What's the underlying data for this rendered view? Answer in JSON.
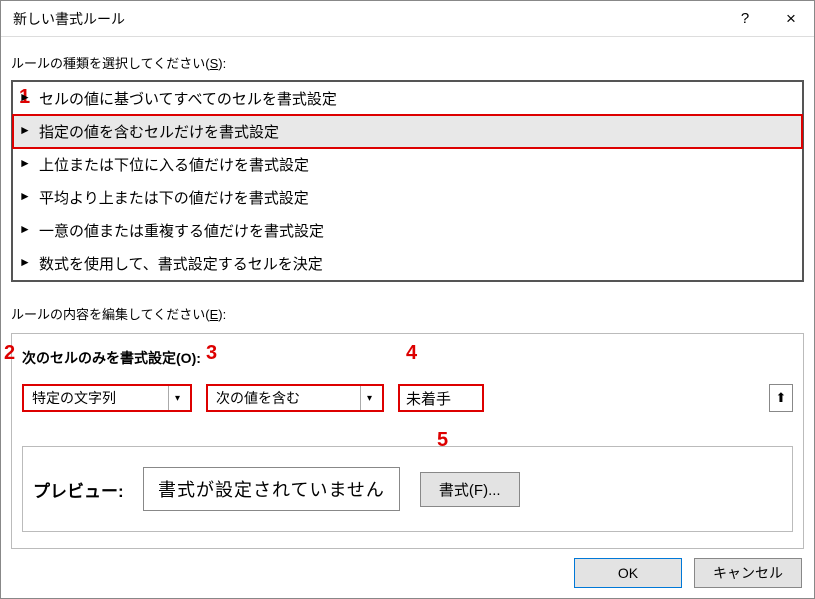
{
  "dialog": {
    "title": "新しい書式ルール",
    "help": "?",
    "close": "×"
  },
  "labels": {
    "selectRuleType": "ルールの種類を選択してください(",
    "selectRuleTypeKey": "S",
    "selectRuleTypeEnd": "):",
    "editRule": "ルールの内容を編集してください(",
    "editRuleKey": "E",
    "editRuleEnd": "):",
    "formatOnly": "次のセルのみを書式設定(",
    "formatOnlyKey": "O",
    "formatOnlyEnd": "):",
    "preview": "プレビュー:",
    "previewText": "書式が設定されていません",
    "formatBtn": "書式(",
    "formatBtnKey": "F",
    "formatBtnEnd": ")..."
  },
  "rules": [
    "セルの値に基づいてすべてのセルを書式設定",
    "指定の値を含むセルだけを書式設定",
    "上位または下位に入る値だけを書式設定",
    "平均より上または下の値だけを書式設定",
    "一意の値または重複する値だけを書式設定",
    "数式を使用して、書式設定するセルを決定"
  ],
  "combo1": "特定の文字列",
  "combo2": "次の値を含む",
  "inputValue": "未着手",
  "footer": {
    "ok": "OK",
    "cancel": "キャンセル"
  },
  "annot": {
    "n1": "1",
    "n2": "2",
    "n3": "3",
    "n4": "4",
    "n5": "5"
  }
}
